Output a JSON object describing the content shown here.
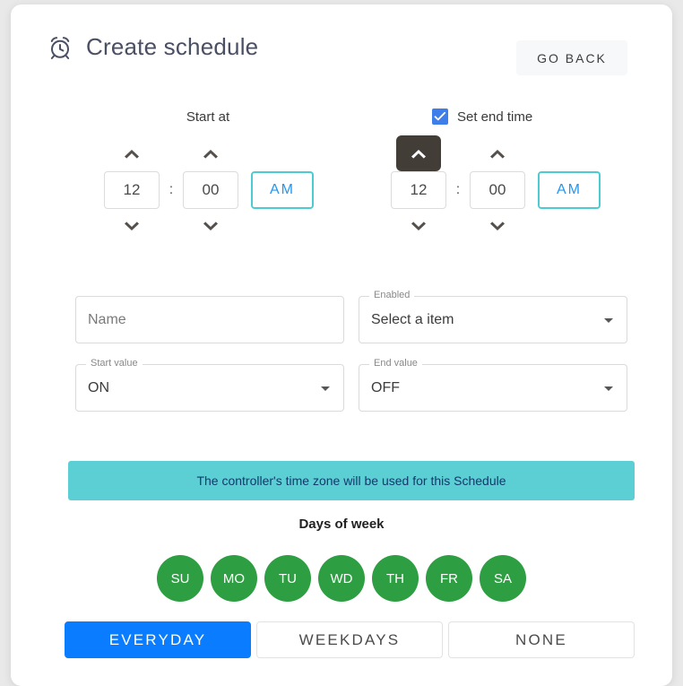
{
  "header": {
    "icon": "alarm-clock-icon",
    "title": "Create schedule",
    "go_back_label": "GO BACK"
  },
  "start_time": {
    "label": "Start at",
    "hour": "12",
    "separator": ":",
    "minute": "00",
    "meridiem": "AM",
    "hour_up_icon": "chevron-up-icon",
    "hour_down_icon": "chevron-down-icon",
    "minute_up_icon": "chevron-up-icon",
    "minute_down_icon": "chevron-down-icon"
  },
  "end_time": {
    "checkbox_label": "Set end time",
    "checked": true,
    "hour": "12",
    "separator": ":",
    "minute": "00",
    "meridiem": "AM",
    "hour_up_icon": "chevron-up-icon",
    "hour_down_icon": "chevron-down-icon",
    "minute_up_icon": "chevron-up-icon",
    "minute_down_icon": "chevron-down-icon"
  },
  "fields": {
    "name": {
      "placeholder": "Name",
      "value": ""
    },
    "enabled": {
      "legend": "Enabled",
      "value": "Select a item"
    },
    "start_value": {
      "legend": "Start value",
      "value": "ON"
    },
    "end_value": {
      "legend": "End value",
      "value": "OFF"
    }
  },
  "banner": {
    "text": "The controller's time zone will be used for this Schedule"
  },
  "days_of_week": {
    "title": "Days of week",
    "days": [
      {
        "label": "SU",
        "selected": true
      },
      {
        "label": "MO",
        "selected": true
      },
      {
        "label": "TU",
        "selected": true
      },
      {
        "label": "WD",
        "selected": true
      },
      {
        "label": "TH",
        "selected": true
      },
      {
        "label": "FR",
        "selected": true
      },
      {
        "label": "SA",
        "selected": true
      }
    ]
  },
  "presets": [
    {
      "label": "EVERYDAY",
      "active": true
    },
    {
      "label": "WEEKDAYS",
      "active": false
    },
    {
      "label": "NONE",
      "active": false
    }
  ],
  "colors": {
    "accent_blue": "#0a7cff",
    "teal": "#5ccfd4",
    "green": "#2e9e42",
    "dark": "#423d37",
    "checkbox_blue": "#3d7eeb"
  }
}
